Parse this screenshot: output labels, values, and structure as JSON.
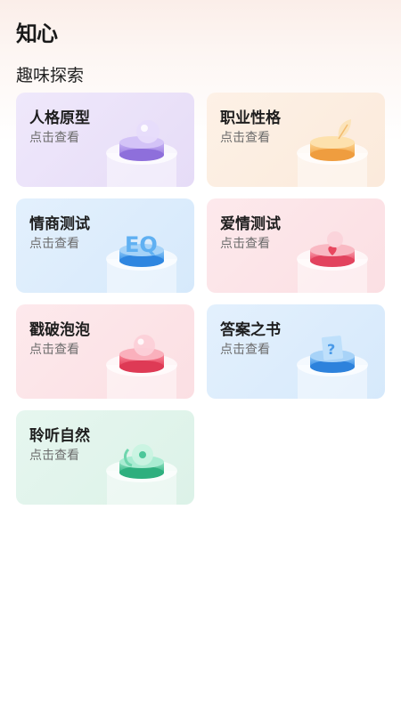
{
  "app": {
    "title": "知心"
  },
  "section": {
    "title": "趣味探索"
  },
  "cards": [
    {
      "title": "人格原型",
      "subtitle": "点击查看",
      "theme": "purple",
      "icon": "bubble-icon"
    },
    {
      "title": "职业性格",
      "subtitle": "点击查看",
      "theme": "orange",
      "icon": "leaf-icon"
    },
    {
      "title": "情商测试",
      "subtitle": "点击查看",
      "theme": "blue",
      "icon": "eq-icon"
    },
    {
      "title": "爱情测试",
      "subtitle": "点击查看",
      "theme": "pink",
      "icon": "heart-icon"
    },
    {
      "title": "戳破泡泡",
      "subtitle": "点击查看",
      "theme": "pink",
      "icon": "bubble-icon"
    },
    {
      "title": "答案之书",
      "subtitle": "点击查看",
      "theme": "blue",
      "icon": "question-book-icon"
    },
    {
      "title": "聆听自然",
      "subtitle": "点击查看",
      "theme": "green",
      "icon": "disc-icon"
    }
  ],
  "colors": {
    "purple": "#a98ae6",
    "orange": "#f5b968",
    "blue": "#4da3f0",
    "pink": "#f06b80",
    "green": "#4cc79a"
  }
}
